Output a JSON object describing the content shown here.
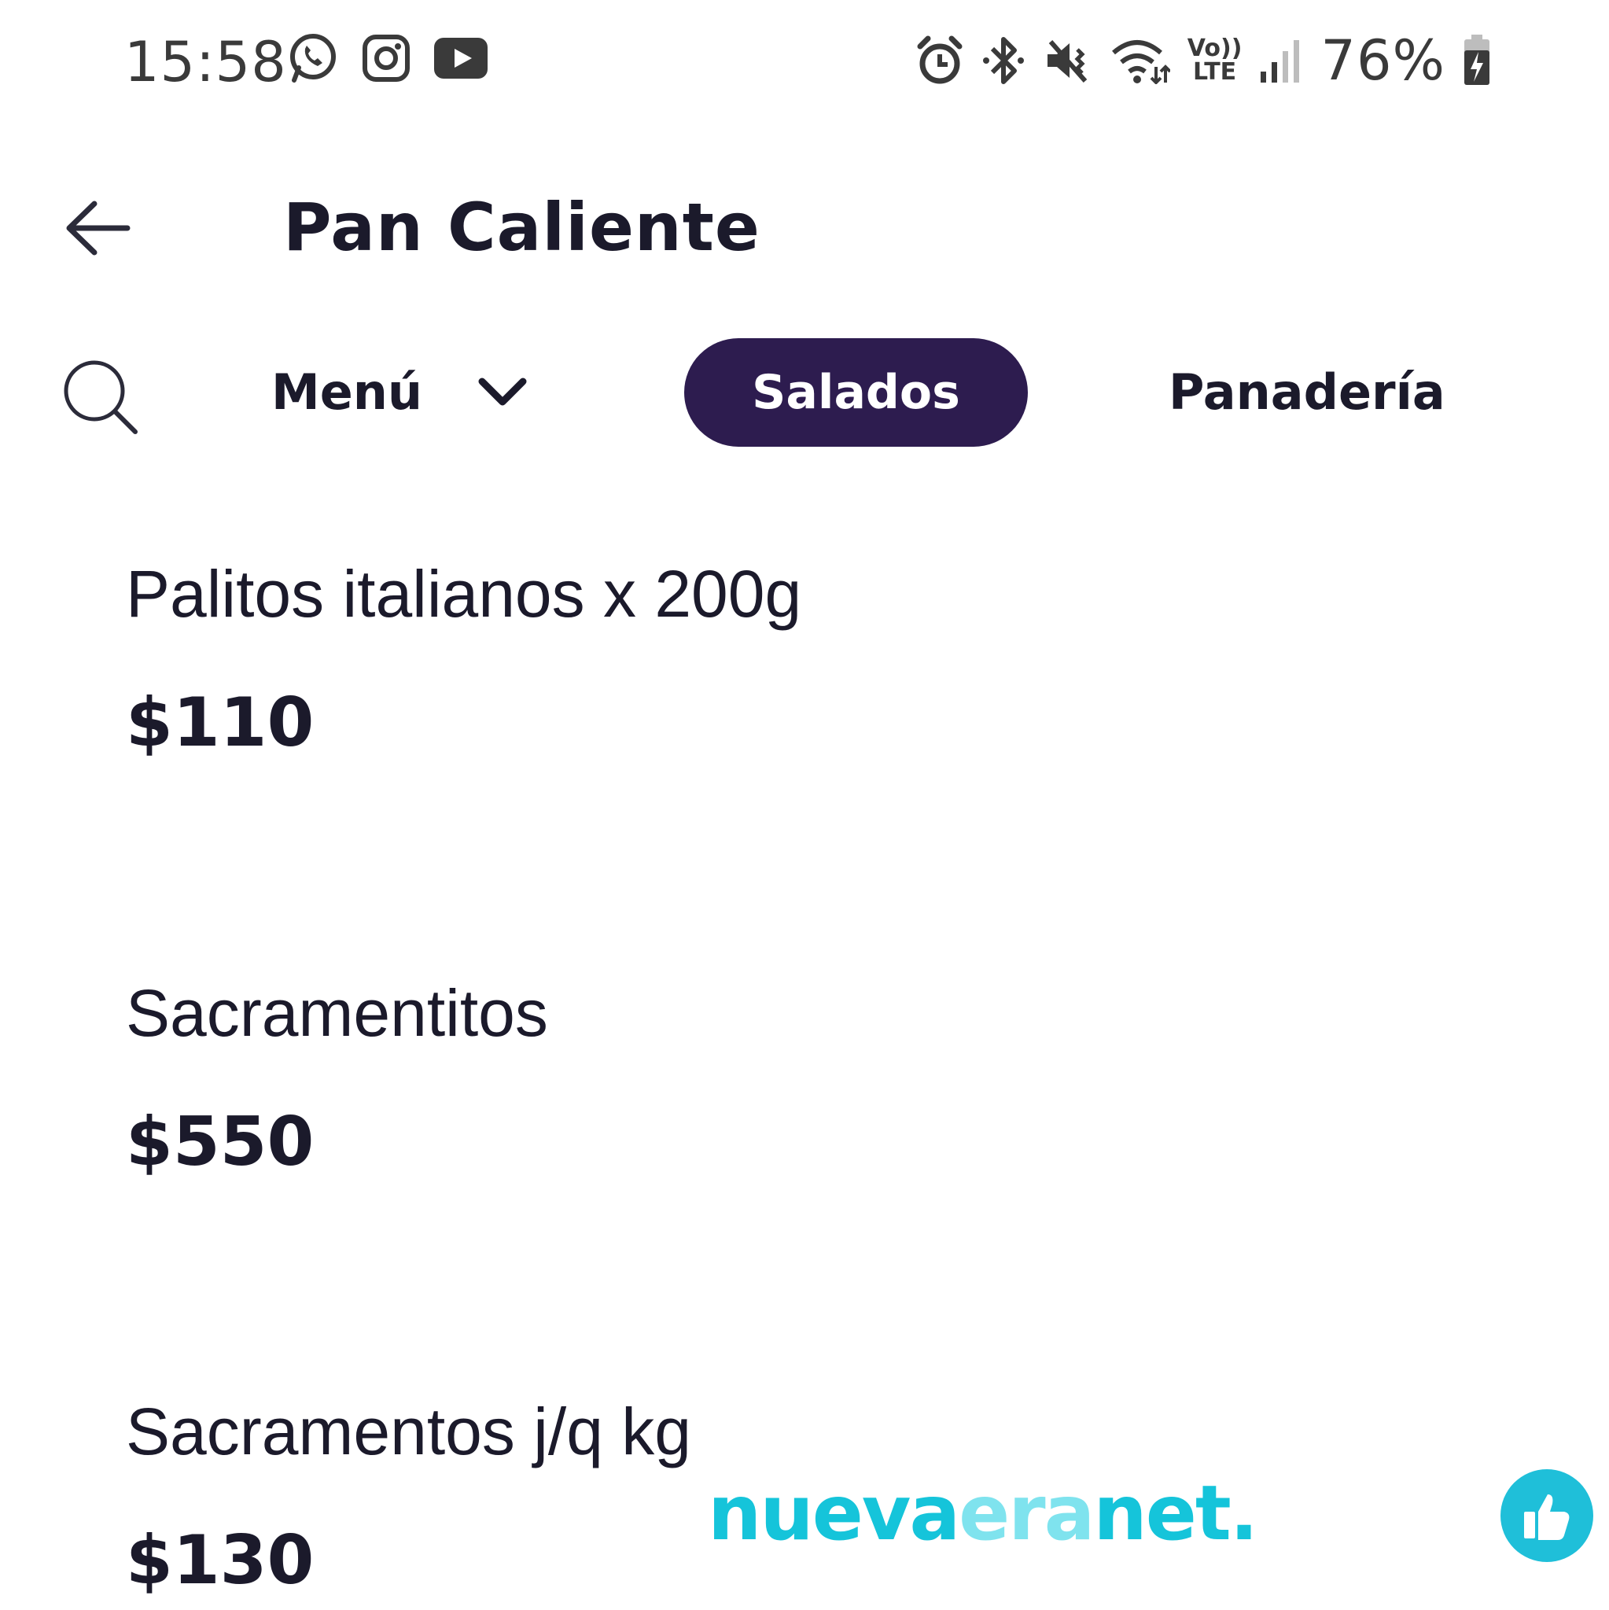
{
  "status_bar": {
    "time": "15:58",
    "app_icons": [
      "whatsapp-icon",
      "instagram-icon",
      "youtube-icon"
    ],
    "system_icons": [
      "alarm-icon",
      "bluetooth-icon",
      "vibrate-mute-icon",
      "wifi-icon",
      "volte-icon",
      "signal-icon",
      "battery-charging-icon"
    ],
    "volte_line1": "Vo))",
    "volte_line2": "LTE",
    "battery": "76%"
  },
  "header": {
    "title": "Pan Caliente"
  },
  "categories": {
    "menu_label": "Menú",
    "active_tab": "Salados",
    "next_tab": "Panadería"
  },
  "products": [
    {
      "name": "Palitos italianos x 200g",
      "price": "$110"
    },
    {
      "name": "Sacramentitos",
      "price": "$550"
    },
    {
      "name": "Sacramentos j/q kg",
      "price": "$130"
    }
  ],
  "watermark": {
    "part1": "nueva",
    "part2": "era",
    "part3": "net."
  },
  "colors": {
    "active_tab_bg": "#2d1c4f",
    "text": "#1b1a2b",
    "watermark": "#15c4da",
    "like_button": "#1fbfd9"
  }
}
